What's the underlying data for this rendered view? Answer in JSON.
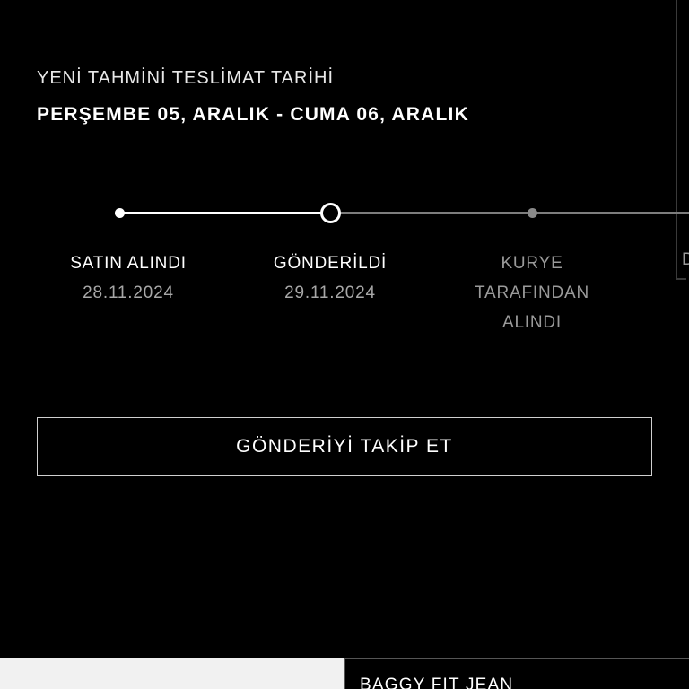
{
  "delivery": {
    "estimate_label": "YENİ TAHMİNİ TESLİMAT TARİHİ",
    "estimate_date": "PERŞEMBE 05, ARALIK - CUMA 06, ARALIK"
  },
  "tracking": {
    "steps": [
      {
        "name": "SATIN ALINDI",
        "date": "28.11.2024",
        "status": "done"
      },
      {
        "name": "GÖNDERİLDİ",
        "date": "29.11.2024",
        "status": "current"
      },
      {
        "name": "KURYE TARAFINDAN ALINDI",
        "date": "",
        "status": "pending"
      },
      {
        "name": "D",
        "date": "",
        "status": "pending"
      }
    ],
    "button_label": "GÖNDERİYİ TAKİP ET"
  },
  "product": {
    "name": "BAGGY FIT JEAN"
  },
  "colors": {
    "background": "#000000",
    "text": "#ffffff",
    "muted": "#9a9a9a",
    "track_done": "#ffffff",
    "track_pending": "#7d7d7d"
  }
}
